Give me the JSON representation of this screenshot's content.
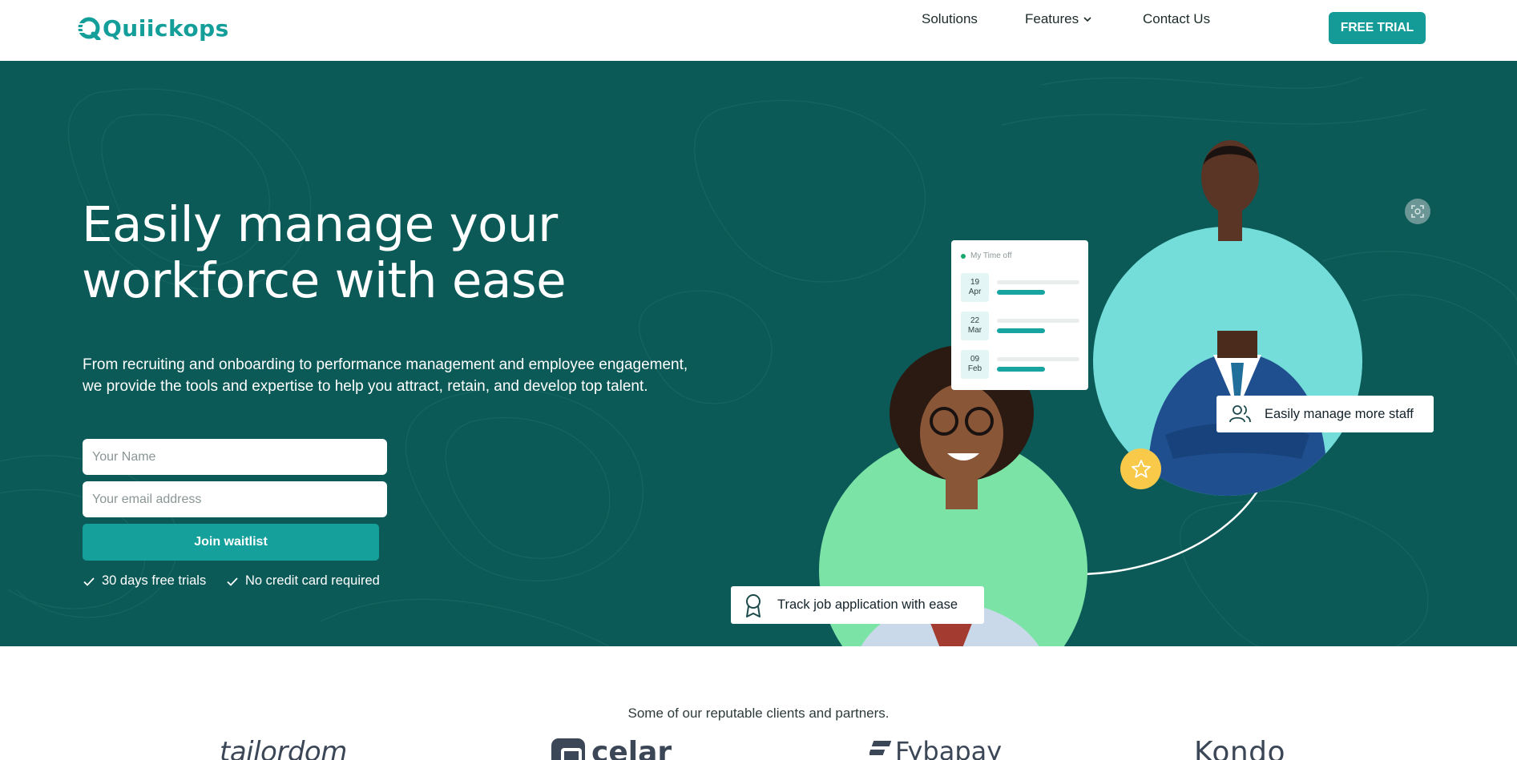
{
  "header": {
    "logo_text": "Quiickops",
    "nav": [
      {
        "label": "Solutions"
      },
      {
        "label": "Features"
      },
      {
        "label": "Contact Us"
      }
    ],
    "cta_label": "FREE TRIAL"
  },
  "hero": {
    "title_line1": "Easily manage your",
    "title_line2": "workforce with ease",
    "subtitle": "From recruiting and onboarding to performance management and employee engagement, we provide the tools and expertise to help you attract, retain, and develop top talent.",
    "name_placeholder": "Your Name",
    "email_placeholder": "Your email address",
    "join_label": "Join waitlist",
    "perks": [
      "30 days free trials",
      "No credit card required"
    ],
    "timeoff": {
      "title": "My Time off",
      "entries": [
        {
          "day": "19",
          "month": "Apr"
        },
        {
          "day": "22",
          "month": "Mar"
        },
        {
          "day": "09",
          "month": "Feb"
        }
      ]
    },
    "staff_pill": "Easily manage more staff",
    "track_pill": "Track job application with ease"
  },
  "partners": {
    "title": "Some of our reputable clients and partners.",
    "logos": [
      "tailordom",
      "celar",
      "Fybapay",
      "Kondo"
    ]
  },
  "colors": {
    "brand": "#149b97",
    "hero_bg": "#0b5a57",
    "accent_green": "#7be3a6",
    "accent_cyan": "#74ddd9",
    "star": "#f9c94a"
  },
  "icons": [
    "logo-mark-icon",
    "chevron-down-icon",
    "check-icon",
    "users-icon",
    "award-icon",
    "star-icon",
    "focus-icon"
  ]
}
